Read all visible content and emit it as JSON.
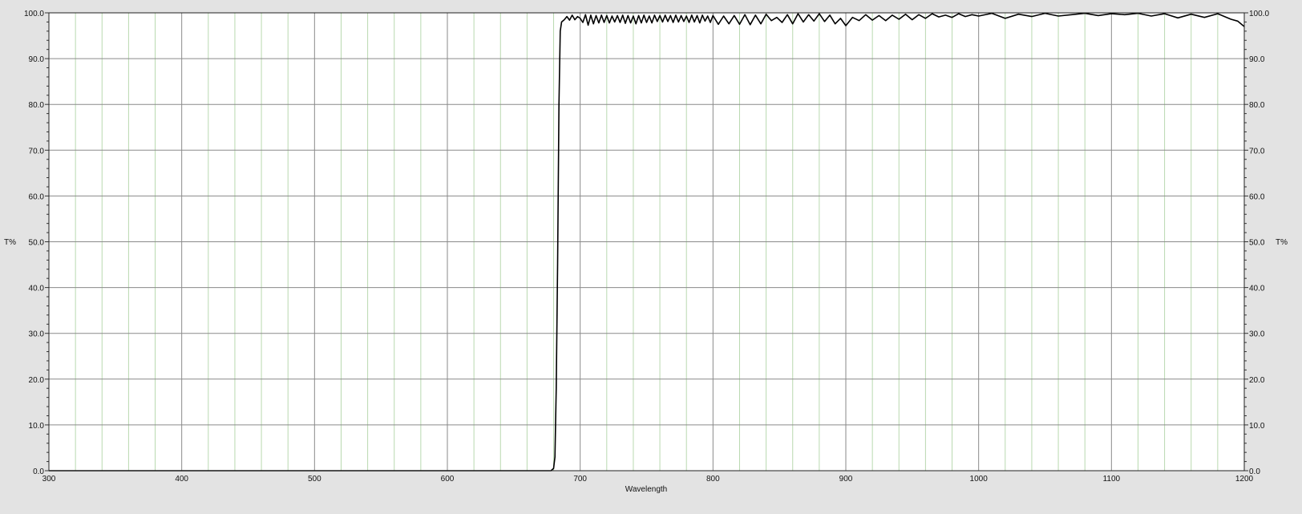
{
  "chart_data": {
    "type": "line",
    "title": "",
    "xlabel": "Wavelength",
    "ylabel": "T%",
    "ylabel_right": "T%",
    "xlim": [
      300,
      1200
    ],
    "ylim": [
      0,
      100
    ],
    "x_ticks": [
      "300",
      "400",
      "500",
      "600",
      "700",
      "800",
      "900",
      "1000",
      "1100",
      "1200"
    ],
    "y_ticks": [
      "0.0",
      "10.0",
      "20.0",
      "30.0",
      "40.0",
      "50.0",
      "60.0",
      "70.0",
      "80.0",
      "90.0",
      "100.0"
    ],
    "x_minor_step": 20,
    "grid": true,
    "legend": "none",
    "colors": {
      "background": "#e3e3e3",
      "plot_area": "#ffffff",
      "major_grid": "#8a8a8a",
      "minor_grid": "#b9d9b0",
      "series": "#000000"
    },
    "series": [
      {
        "name": "",
        "x": [
          300,
          400,
          500,
          600,
          670,
          678,
          680,
          681,
          682,
          683,
          684,
          685,
          686,
          688,
          690,
          692,
          694,
          696,
          698,
          700,
          702,
          704,
          706,
          708,
          710,
          712,
          714,
          716,
          718,
          720,
          722,
          724,
          726,
          728,
          730,
          732,
          734,
          736,
          738,
          740,
          742,
          744,
          746,
          748,
          750,
          752,
          754,
          756,
          758,
          760,
          762,
          764,
          766,
          768,
          770,
          772,
          774,
          776,
          778,
          780,
          782,
          784,
          786,
          788,
          790,
          792,
          794,
          796,
          798,
          800,
          804,
          808,
          812,
          816,
          820,
          824,
          828,
          832,
          836,
          840,
          844,
          848,
          852,
          856,
          860,
          864,
          868,
          872,
          876,
          880,
          884,
          888,
          892,
          896,
          900,
          905,
          910,
          915,
          920,
          925,
          930,
          935,
          940,
          945,
          950,
          955,
          960,
          965,
          970,
          975,
          980,
          985,
          990,
          995,
          1000,
          1010,
          1020,
          1030,
          1040,
          1050,
          1060,
          1070,
          1080,
          1090,
          1100,
          1110,
          1120,
          1130,
          1140,
          1150,
          1160,
          1170,
          1180,
          1190,
          1195,
          1200
        ],
        "values": [
          0,
          0,
          0,
          0,
          0,
          0,
          0.5,
          3,
          18,
          45,
          80,
          96,
          98,
          98.5,
          99.2,
          98.4,
          99.5,
          98.5,
          99.2,
          98.8,
          97.9,
          99.6,
          97.3,
          99.5,
          97.6,
          99.4,
          97.8,
          99.5,
          97.9,
          99.4,
          97.8,
          99.3,
          98.0,
          99.4,
          97.9,
          99.5,
          97.7,
          99.4,
          97.8,
          99.3,
          97.6,
          99.4,
          97.8,
          99.5,
          97.9,
          99.3,
          97.8,
          99.5,
          98.1,
          99.4,
          98.0,
          99.5,
          98.1,
          99.4,
          97.9,
          99.5,
          98.0,
          99.4,
          98.1,
          99.3,
          97.9,
          99.5,
          98.0,
          99.4,
          97.8,
          99.5,
          98.2,
          99.3,
          97.9,
          99.4,
          97.5,
          99.3,
          97.6,
          99.4,
          97.5,
          99.6,
          97.4,
          99.5,
          97.6,
          99.7,
          98.3,
          99.0,
          97.9,
          99.6,
          97.6,
          99.8,
          98.0,
          99.6,
          98.2,
          99.8,
          98.1,
          99.5,
          97.6,
          98.8,
          97.2,
          99.0,
          98.3,
          99.6,
          98.4,
          99.4,
          98.3,
          99.5,
          98.6,
          99.7,
          98.5,
          99.6,
          98.8,
          99.8,
          99.1,
          99.5,
          99.0,
          99.8,
          99.2,
          99.6,
          99.3,
          99.9,
          98.8,
          99.7,
          99.2,
          99.9,
          99.3,
          99.6,
          99.9,
          99.4,
          99.8,
          99.6,
          99.9,
          99.3,
          99.8,
          98.9,
          99.7,
          99.0,
          99.8,
          98.6,
          98.2,
          97.0
        ]
      }
    ]
  }
}
